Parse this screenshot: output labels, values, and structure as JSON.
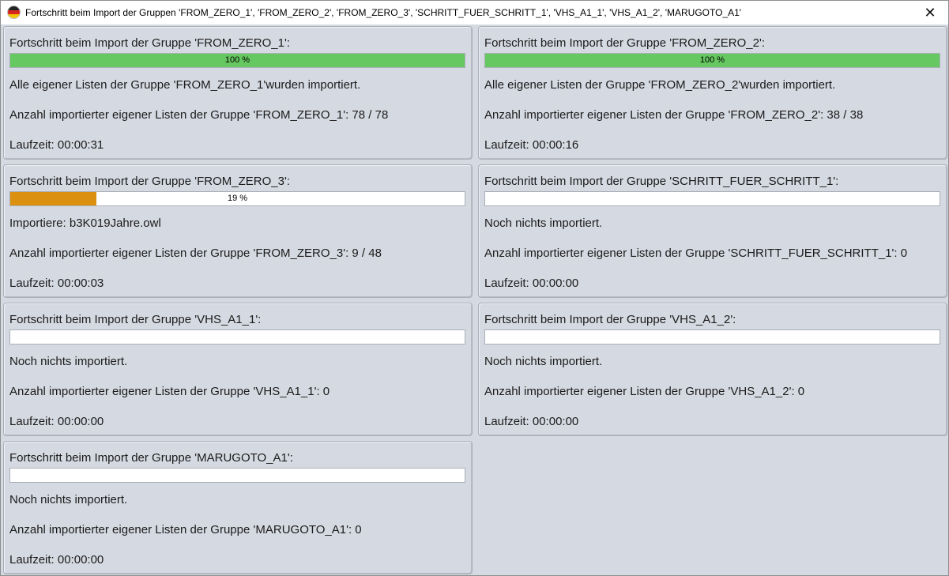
{
  "window": {
    "title": "Fortschritt beim Import der Gruppen 'FROM_ZERO_1', 'FROM_ZERO_2', 'FROM_ZERO_3', 'SCHRITT_FUER_SCHRITT_1', 'VHS_A1_1', 'VHS_A1_2', 'MARUGOTO_A1'",
    "close_label": "✕",
    "app_icon": "german-flag-circle-icon"
  },
  "colors": {
    "complete": "#66c860",
    "in_progress": "#dc9010"
  },
  "panels": [
    {
      "title": "Fortschritt beim Import der Gruppe 'FROM_ZERO_1':",
      "progress": 100,
      "progress_label": "100 %",
      "status": "Alle eigener Listen der Gruppe 'FROM_ZERO_1'wurden importiert.",
      "count": "Anzahl importierter eigener Listen der Gruppe 'FROM_ZERO_1': 78 / 78",
      "runtime": "Laufzeit: 00:00:31"
    },
    {
      "title": "Fortschritt beim Import der Gruppe 'FROM_ZERO_2':",
      "progress": 100,
      "progress_label": "100 %",
      "status": "Alle eigener Listen der Gruppe 'FROM_ZERO_2'wurden importiert.",
      "count": "Anzahl importierter eigener Listen der Gruppe 'FROM_ZERO_2': 38 / 38",
      "runtime": "Laufzeit: 00:00:16"
    },
    {
      "title": "Fortschritt beim Import der Gruppe 'FROM_ZERO_3':",
      "progress": 19,
      "progress_label": "19 %",
      "status": "Importiere: b3K019Jahre.owl",
      "count": "Anzahl importierter eigener Listen der Gruppe 'FROM_ZERO_3': 9 / 48",
      "runtime": "Laufzeit: 00:00:03"
    },
    {
      "title": "Fortschritt beim Import der Gruppe 'SCHRITT_FUER_SCHRITT_1':",
      "progress": 0,
      "progress_label": "",
      "status": "Noch nichts importiert.",
      "count": "Anzahl importierter eigener Listen der Gruppe 'SCHRITT_FUER_SCHRITT_1': 0",
      "runtime": "Laufzeit: 00:00:00"
    },
    {
      "title": "Fortschritt beim Import der Gruppe 'VHS_A1_1':",
      "progress": 0,
      "progress_label": "",
      "status": "Noch nichts importiert.",
      "count": "Anzahl importierter eigener Listen der Gruppe 'VHS_A1_1': 0",
      "runtime": "Laufzeit: 00:00:00"
    },
    {
      "title": "Fortschritt beim Import der Gruppe 'VHS_A1_2':",
      "progress": 0,
      "progress_label": "",
      "status": "Noch nichts importiert.",
      "count": "Anzahl importierter eigener Listen der Gruppe 'VHS_A1_2': 0",
      "runtime": "Laufzeit: 00:00:00"
    },
    {
      "title": "Fortschritt beim Import der Gruppe 'MARUGOTO_A1':",
      "progress": 0,
      "progress_label": "",
      "status": "Noch nichts importiert.",
      "count": "Anzahl importierter eigener Listen der Gruppe 'MARUGOTO_A1': 0",
      "runtime": "Laufzeit: 00:00:00"
    }
  ]
}
